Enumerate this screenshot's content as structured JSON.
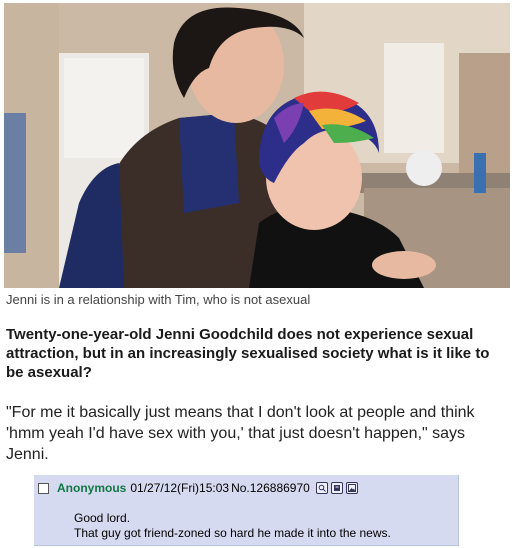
{
  "article": {
    "caption": "Jenni is in a relationship with Tim, who is not asexual",
    "lead": "Twenty-one-year-old Jenni Goodchild does not experience sexual attraction, but in an increasingly sexualised society what is it like to be asexual?",
    "quote": "\"For me it basically just means that I don't look at people and think 'hmm yeah I'd have sex with you,' that just doesn't happen,\" says Jenni."
  },
  "post": {
    "name": "Anonymous",
    "datetime": "01/27/12(Fri)15:03",
    "number": "No.126886970",
    "lines": [
      "Good lord.",
      "That guy got friend-zoned so hard he made it into the news."
    ]
  },
  "colors": {
    "post_bg": "#d6daf0",
    "name_green": "#117743"
  }
}
